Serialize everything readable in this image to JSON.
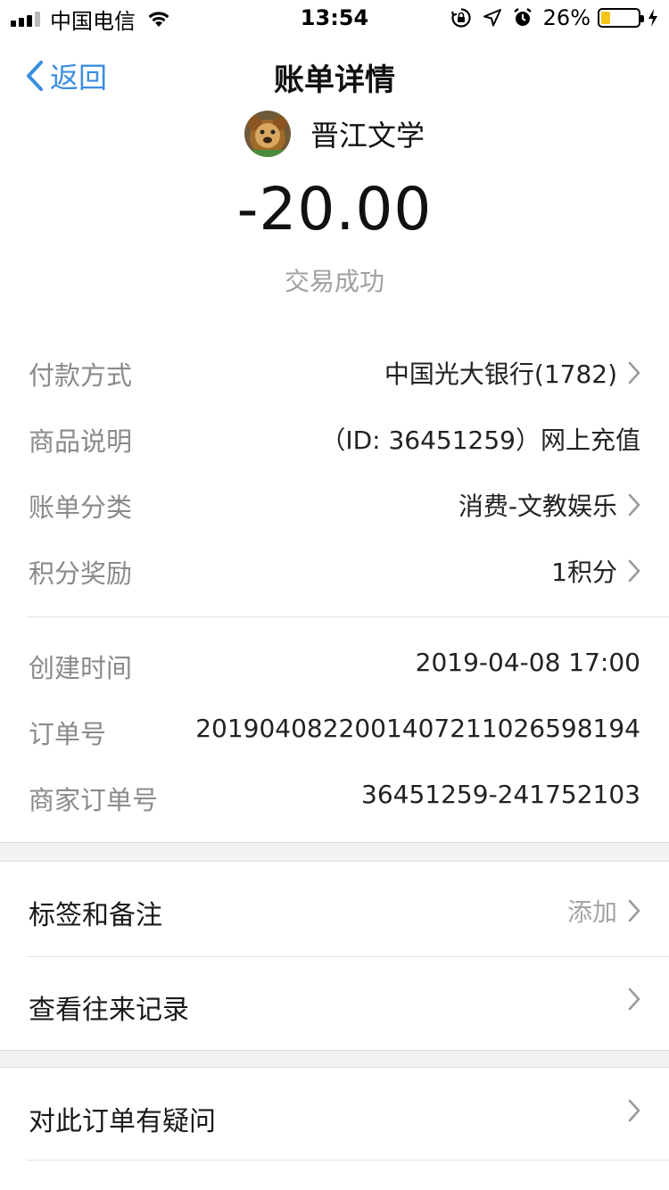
{
  "status_bar": {
    "carrier": "中国电信",
    "time": "13:54",
    "battery_percent": "26%",
    "battery_level": 0.26,
    "icons": [
      "signal-icon",
      "wifi-icon",
      "orientation-lock-icon",
      "location-icon",
      "alarm-icon",
      "battery-icon",
      "charging-icon"
    ]
  },
  "nav": {
    "back_label": "返回",
    "title": "账单详情"
  },
  "header": {
    "merchant": "晋江文学",
    "amount": "-20.00",
    "status": "交易成功"
  },
  "details": [
    {
      "label": "付款方式",
      "value": "中国光大银行(1782)",
      "chevron": true
    },
    {
      "label": "商品说明",
      "value": "（ID: 36451259）网上充值",
      "chevron": false
    },
    {
      "label": "账单分类",
      "value": "消费-文教娱乐",
      "chevron": true
    },
    {
      "label": "积分奖励",
      "value": "1积分",
      "chevron": true
    }
  ],
  "order_info": [
    {
      "label": "创建时间",
      "value": "2019-04-08 17:00"
    },
    {
      "label": "订单号",
      "value": "20190408220014072110265981​94"
    },
    {
      "label": "商家订单号",
      "value": "36451259-241752103"
    }
  ],
  "actions": {
    "tags": {
      "label": "标签和备注",
      "right": "添加"
    },
    "history": {
      "label": "查看往来记录"
    },
    "question": {
      "label": "对此订单有疑问"
    }
  },
  "colors": {
    "accent": "#3b8ee0",
    "battery": "#f5c518",
    "muted": "#8a8a8a"
  }
}
